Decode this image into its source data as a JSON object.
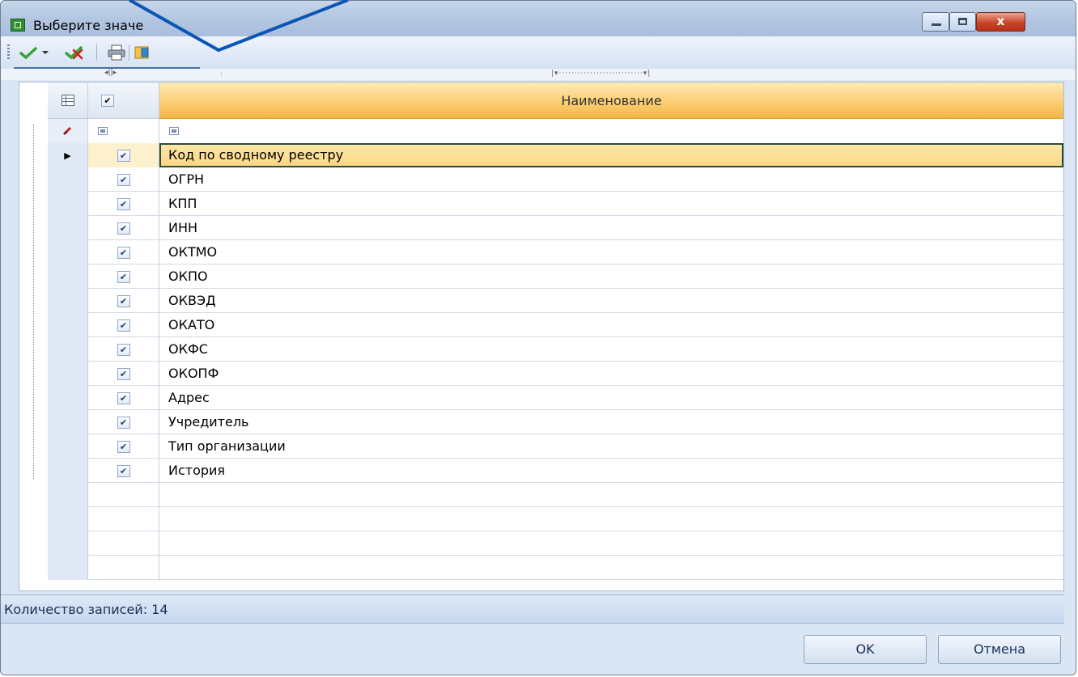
{
  "window": {
    "title": "Выберите значе",
    "min_icon": "minimize-icon",
    "max_icon": "maximize-icon",
    "close_glyph": "x"
  },
  "toolbar": {
    "items": [
      "ok-check-icon",
      "dropdown-arrow-icon",
      "cancel-check-icon",
      "printer-icon",
      "export-icon"
    ]
  },
  "grid": {
    "header": {
      "name_column": "Наименование"
    },
    "rows": [
      {
        "checked": true,
        "label": "Код по сводному реестру",
        "selected": true
      },
      {
        "checked": true,
        "label": "ОГРН"
      },
      {
        "checked": true,
        "label": "КПП"
      },
      {
        "checked": true,
        "label": "ИНН"
      },
      {
        "checked": true,
        "label": "ОКТМО"
      },
      {
        "checked": true,
        "label": "ОКПО"
      },
      {
        "checked": true,
        "label": "ОКВЭД"
      },
      {
        "checked": true,
        "label": "ОКАТО"
      },
      {
        "checked": true,
        "label": "ОКФС"
      },
      {
        "checked": true,
        "label": "ОКОПФ"
      },
      {
        "checked": true,
        "label": "Адрес"
      },
      {
        "checked": true,
        "label": "Учредитель"
      },
      {
        "checked": true,
        "label": "Тип организации"
      },
      {
        "checked": true,
        "label": "История"
      }
    ],
    "row_indicator": "▶",
    "check_glyph": "✔"
  },
  "status": {
    "text": "Количество записей: 14"
  },
  "buttons": {
    "ok": "OK",
    "cancel": "Отмена"
  },
  "colors": {
    "header_accent": "#f5b547",
    "selection": "#fbd785",
    "chrome": "#dbe6f4",
    "pointer_line": "#0b55b5"
  }
}
